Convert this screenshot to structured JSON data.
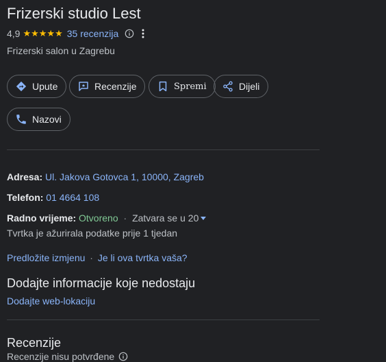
{
  "business": {
    "name": "Frizerski studio Lest",
    "rating": "4,9",
    "stars": "★★★★★",
    "reviews_link": "35 recenzija",
    "category": "Frizerski salon u Zagrebu"
  },
  "actions": [
    {
      "label": "Upute",
      "icon": "directions-icon"
    },
    {
      "label": "Recenzije",
      "icon": "review-icon"
    },
    {
      "label": "Spremi",
      "icon": "bookmark-icon"
    },
    {
      "label": "Dijeli",
      "icon": "share-icon"
    },
    {
      "label": "Nazovi",
      "icon": "phone-icon"
    }
  ],
  "details": {
    "address_label": "Adresa:",
    "address_value": "Ul. Jakova Gotovca 1, 10000, Zagreb",
    "phone_label": "Telefon:",
    "phone_value": "01 4664 108",
    "hours_label": "Radno vrijeme:",
    "hours_status": "Otvoreno",
    "hours_dot": "·",
    "hours_closes": "Zatvara se u 20",
    "updated_note": "Tvrtka je ažurirala podatke prije 1 tjedan"
  },
  "links": {
    "suggest_edit": "Predložite izmjenu",
    "separator": "·",
    "own_business": "Je li ova tvrtka vaša?"
  },
  "missing_info": {
    "heading": "Dodajte informacije koje nedostaju",
    "add_website": "Dodajte web-lokaciju"
  },
  "reviews_section": {
    "heading": "Recenzije",
    "note": "Recenzije nisu potvrđene"
  },
  "colors": {
    "background": "#202124",
    "link": "#8ab4f8",
    "open": "#81c995",
    "star": "#fbbc04"
  }
}
